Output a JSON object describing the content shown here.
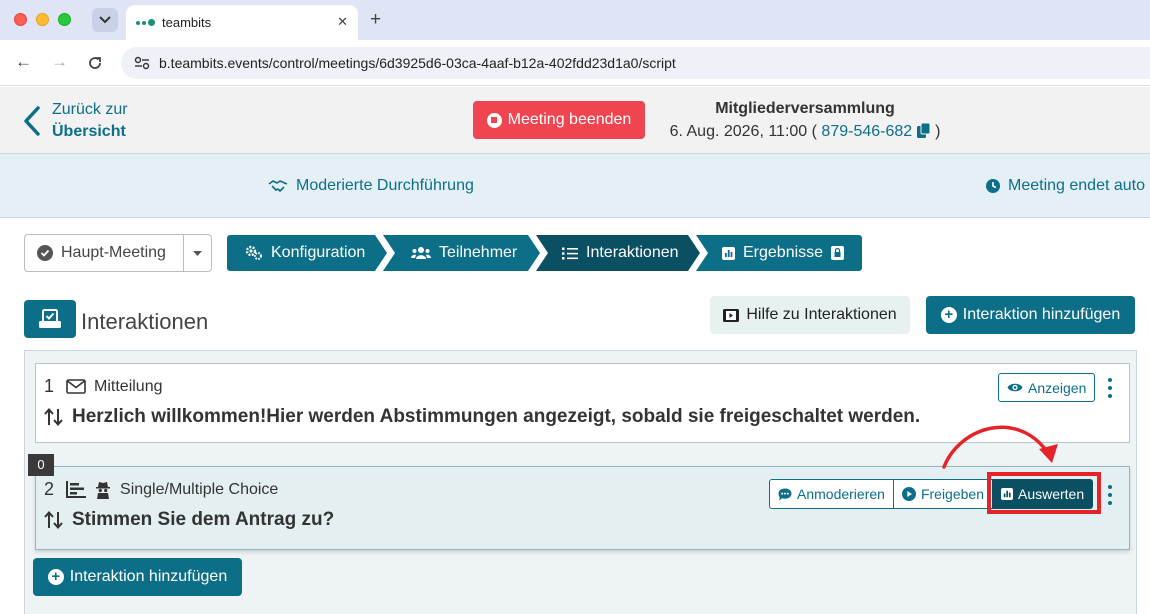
{
  "browser": {
    "tab_title": "teambits",
    "url": "b.teambits.events/control/meetings/6d3925d6-03ca-4aaf-b12a-402fdd23d1a0/script"
  },
  "header": {
    "back_line1": "Zurück zur",
    "back_line2": "Übersicht",
    "end_meeting_label": "Meeting beenden",
    "meeting_title": "Mitgliederversammlung",
    "meeting_date": "6. Aug. 2026, 11:00 (",
    "meeting_id": "879-546-682",
    "meeting_close": ")"
  },
  "modebar": {
    "moderated_label": "Moderierte Durchführung",
    "auto_end_label": "Meeting endet auto"
  },
  "workflow": {
    "meeting_select_value": "Haupt-Meeting",
    "steps": [
      {
        "label": "Konfiguration"
      },
      {
        "label": "Teilnehmer"
      },
      {
        "label": "Interaktionen"
      },
      {
        "label": "Ergebnisse"
      }
    ]
  },
  "section": {
    "title": "Interaktionen",
    "help_label": "Hilfe zu Interaktionen",
    "add_label": "Interaktion hinzufügen"
  },
  "interactions": [
    {
      "number": "1",
      "type": "Mitteilung",
      "text": "Herzlich willkommen!Hier werden Abstimmungen angezeigt, sobald sie freigeschaltet werden.",
      "action_label": "Anzeigen"
    },
    {
      "number": "2",
      "type": "Single/Multiple Choice",
      "text": "Stimmen Sie dem Antrag zu?",
      "badge": "0",
      "moderate_label": "Anmoderieren",
      "release_label": "Freigeben",
      "evaluate_label": "Auswerten"
    }
  ],
  "colors": {
    "primary": "#0d6e88",
    "primary_dark": "#0a4f62",
    "danger": "#ef4550",
    "annotation_red": "#e5242a"
  }
}
